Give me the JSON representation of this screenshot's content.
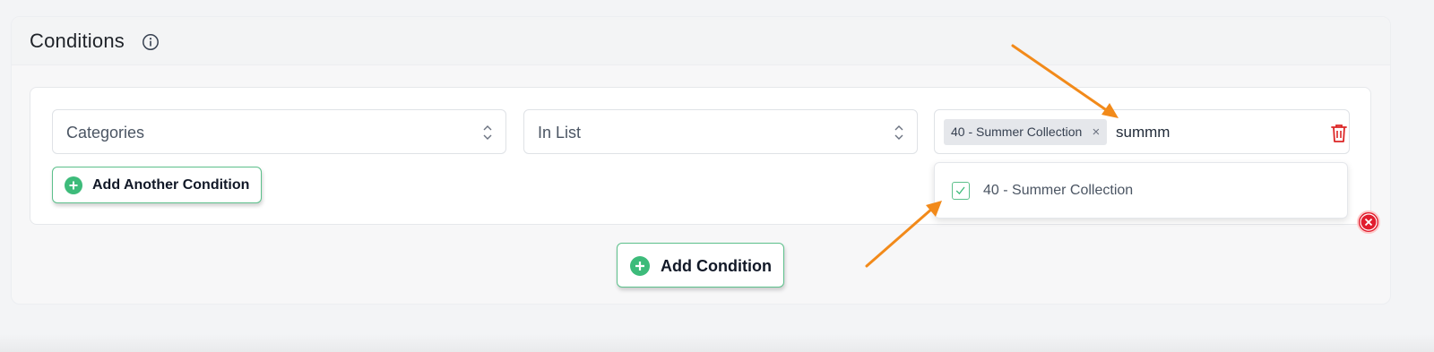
{
  "section": {
    "title": "Conditions",
    "info_icon": "info-icon"
  },
  "condition_row": {
    "field_value": "Categories",
    "operator_value": "In List",
    "selected_tags": [
      {
        "label": "40 - Summer Collection",
        "remove_icon": "×"
      }
    ],
    "search_text": "summm"
  },
  "dropdown": {
    "options": [
      {
        "label": "40 - Summer Collection",
        "checked": true
      }
    ]
  },
  "buttons": {
    "add_another_condition": "Add Another Condition",
    "add_condition": "Add Condition"
  },
  "colors": {
    "accent_green": "#5cc08b",
    "delete_red": "#dc2626",
    "annotation_orange": "#f28a1a"
  }
}
